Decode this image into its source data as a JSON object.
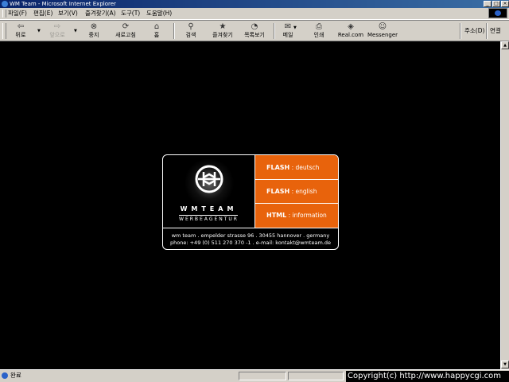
{
  "window": {
    "title": "WM Team - Microsoft Internet Explorer",
    "minimize": "_",
    "maximize": "□",
    "close": "×"
  },
  "menu": [
    "파일(F)",
    "편집(E)",
    "보기(V)",
    "즐겨찾기(A)",
    "도구(T)",
    "도움말(H)"
  ],
  "toolbar": {
    "back": "뒤로",
    "forward": "앞으로",
    "stop": "중지",
    "refresh": "새로고침",
    "home": "홈",
    "search": "검색",
    "favorites": "즐겨찾기",
    "history": "목록보기",
    "mail": "메일",
    "print": "인쇄",
    "realcom": "Real.com",
    "messenger": "Messenger",
    "address_label": "주소(D)",
    "links_label": "연결"
  },
  "icons": {
    "back": "back-arrow-icon",
    "forward": "forward-arrow-icon",
    "stop": "stop-icon",
    "refresh": "refresh-icon",
    "home": "home-icon",
    "search": "search-icon",
    "favorites": "favorites-icon",
    "history": "history-icon",
    "mail": "mail-icon",
    "print": "printer-icon",
    "realcom": "realcom-icon",
    "messenger": "messenger-icon"
  },
  "card": {
    "brand": "WMTEAM",
    "subbrand": "WERBEAGENTUR",
    "options": [
      {
        "key": "FLASH",
        "sep": " : ",
        "label": "deutsch"
      },
      {
        "key": "FLASH",
        "sep": " : ",
        "label": "english"
      },
      {
        "key": "HTML",
        "sep": " : ",
        "label": "information"
      }
    ],
    "address_line1": "wm team . empelder strasse 96 . 30455 hannover . germany",
    "address_line2": "phone: +49 (0) 511 270 370 -1 . e-mail: kontakt@wmteam.de"
  },
  "status": {
    "text": "완료"
  },
  "copyright": "Copyright(c) http://www.happycgi.com",
  "colors": {
    "accent_orange": "#e8630c",
    "page_bg": "#000000",
    "chrome": "#d4d0c8",
    "titlebar": "#0a246a"
  }
}
